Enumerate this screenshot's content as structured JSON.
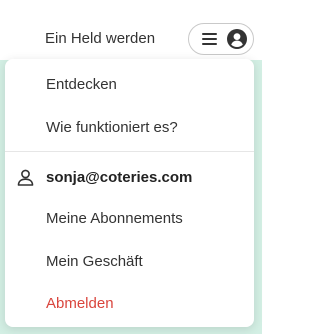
{
  "header": {
    "become_hero_label": "Ein Held werden",
    "menu_icon": "hamburger-menu-icon",
    "avatar_icon": "user-avatar-icon"
  },
  "menu": {
    "items": [
      {
        "label": "Entdecken"
      },
      {
        "label": "Wie funktioniert es?"
      }
    ],
    "account": {
      "icon": "user-icon",
      "email": "sonja@coteries.com",
      "items": [
        {
          "label": "Meine Abonnements"
        },
        {
          "label": "Mein Geschäft"
        }
      ],
      "logout_label": "Abmelden"
    }
  },
  "colors": {
    "background_accent": "#d3efe4",
    "logout": "#d9453d",
    "text": "#333333"
  }
}
